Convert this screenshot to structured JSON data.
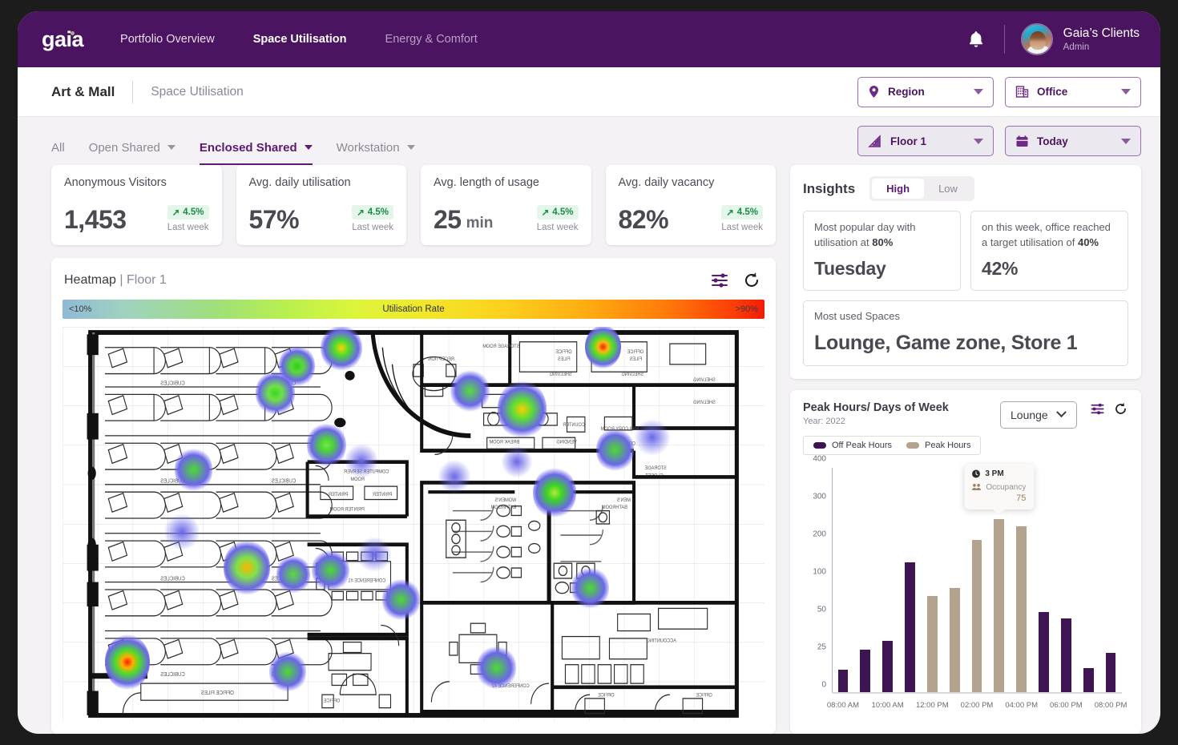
{
  "topnav": {
    "logo": "gaia",
    "links": [
      {
        "label": "Portfolio Overview",
        "state": "normal"
      },
      {
        "label": "Space Utilisation",
        "state": "active"
      },
      {
        "label": "Energy & Comfort",
        "state": "dim"
      }
    ],
    "bell_icon": "bell-icon",
    "user": {
      "name": "Gaia’s Clients",
      "role": "Admin"
    }
  },
  "breadcrumb": {
    "main": "Art & Mall",
    "sub": "Space Utilisation",
    "region_label": "Region",
    "office_label": "Office"
  },
  "tabs": [
    {
      "label": "All",
      "caret": false,
      "active": false
    },
    {
      "label": "Open Shared",
      "caret": true,
      "active": false
    },
    {
      "label": "Enclosed Shared",
      "caret": true,
      "active": true
    },
    {
      "label": "Workstation",
      "caret": true,
      "active": false
    }
  ],
  "filters": {
    "floor_label": "Floor 1",
    "date_label": "Today"
  },
  "kpis": [
    {
      "title": "Anonymous Visitors",
      "value": "1,453",
      "unit": "",
      "delta": "4.5%",
      "sub": "Last week"
    },
    {
      "title": "Avg. daily utilisation",
      "value": "57%",
      "unit": "",
      "delta": "4.5%",
      "sub": "Last week"
    },
    {
      "title": "Avg. length of usage",
      "value": "25",
      "unit": "min",
      "delta": "4.5%",
      "sub": "Last week"
    },
    {
      "title": "Avg. daily vacancy",
      "value": "82%",
      "unit": "",
      "delta": "4.5%",
      "sub": "Last week"
    }
  ],
  "heatmap": {
    "title": "Heatmap",
    "title_sep": "|",
    "title_sub": "Floor 1",
    "filter_icon": "sliders-icon",
    "refresh_icon": "refresh-icon",
    "legend_low": "<10%",
    "legend_mid": "Utilisation Rate",
    "legend_high": ">90%",
    "room_labels": [
      "CUBICLES",
      "CUBICLES",
      "CUBICLES",
      "CUBICLES",
      "CUBICLES",
      "CUBICLES",
      "CUBICLES",
      "CUBICLES",
      "OFFICE FILES",
      "RECEPTION",
      "CONFERENCE",
      "COMPUTER SERVER ROOM",
      "PRINTER",
      "PRINTER",
      "PRINTER ROOM",
      "CONFERENCE #1",
      "OFFICE",
      "STORAGE ROOM",
      "OFFICE FILES",
      "SHELVING",
      "SHELVING",
      "SHELVING",
      "BREAK ROOM",
      "DESK",
      "COUNTER",
      "MAILCOPY ROOM",
      "COPIER",
      "VENDING",
      "STORAGE CLOSET",
      "WOMEN'S BATHROOM",
      "MEN'S BATHROOM",
      "CONFERENCE #2",
      "ACCOUNTING",
      "OFFICE",
      "OFFICE",
      "OFFICE"
    ]
  },
  "insights": {
    "title": "Insights",
    "segments": [
      {
        "label": "High",
        "on": true
      },
      {
        "label": "Low",
        "on": false
      }
    ],
    "cards": [
      {
        "caption_pre": "Most popular day with utilisation at ",
        "caption_bold": "80%",
        "value": "Tuesday"
      },
      {
        "caption_pre": "on this week, office reached a target utilisation of ",
        "caption_bold": "40%",
        "value": "42%"
      }
    ],
    "wide": {
      "caption": "Most used Spaces",
      "value": "Lounge, Game zone, Store 1"
    }
  },
  "chart_panel": {
    "title": "Peak Hours/ Days of Week",
    "year": "Year: 2022",
    "select_value": "Lounge",
    "filter_icon": "sliders-icon",
    "refresh_icon": "refresh-icon",
    "tooltip": {
      "clock_icon": "clock-icon",
      "time": "3 PM",
      "people_icon": "people-icon",
      "metric": "Occupancy",
      "value": "75"
    }
  },
  "chart_data": {
    "type": "bar",
    "title": "Peak Hours/ Days of Week",
    "subtitle": "Year: 2022",
    "xlabel": "",
    "ylabel": "",
    "grid": false,
    "legend_position": "top-left",
    "legend": [
      {
        "name": "Off Peak Hours",
        "color": "#3E1452"
      },
      {
        "name": "Peak Hours",
        "color": "#B3A28D"
      }
    ],
    "y_ticks": [
      0,
      25,
      50,
      100,
      200,
      300,
      400
    ],
    "ylim": [
      0,
      400
    ],
    "y_scale": "piecewise",
    "x_tick_labels": [
      "08:00 AM",
      "10:00 AM",
      "12:00 PM",
      "02:00 PM",
      "04:00 PM",
      "06:00 PM",
      "08:00 PM"
    ],
    "categories": [
      "08:00 AM",
      "09:00 AM",
      "10:00 AM",
      "11:00 AM",
      "12:00 PM",
      "01:00 PM",
      "02:00 PM",
      "03:00 PM",
      "04:00 PM",
      "05:00 PM",
      "06:00 PM",
      "07:00 PM",
      "08:00 PM"
    ],
    "values": [
      16,
      29,
      35,
      148,
      80,
      90,
      207,
      263,
      245,
      58,
      50,
      17,
      27
    ],
    "bar_series": [
      "off",
      "off",
      "off",
      "off",
      "peak",
      "peak",
      "peak",
      "peak",
      "peak",
      "off",
      "off",
      "off",
      "off"
    ],
    "annotation": {
      "category": "03:00 PM",
      "label": "3 PM",
      "metric": "Occupancy",
      "value": 75
    }
  },
  "colors": {
    "brand_purple": "#4B1460",
    "accent_purple": "#5C1A74",
    "bar_off_peak": "#3E1452",
    "bar_peak": "#B3A28D",
    "delta_green": "#1E8A45",
    "page_bg": "#F4F2F5"
  }
}
